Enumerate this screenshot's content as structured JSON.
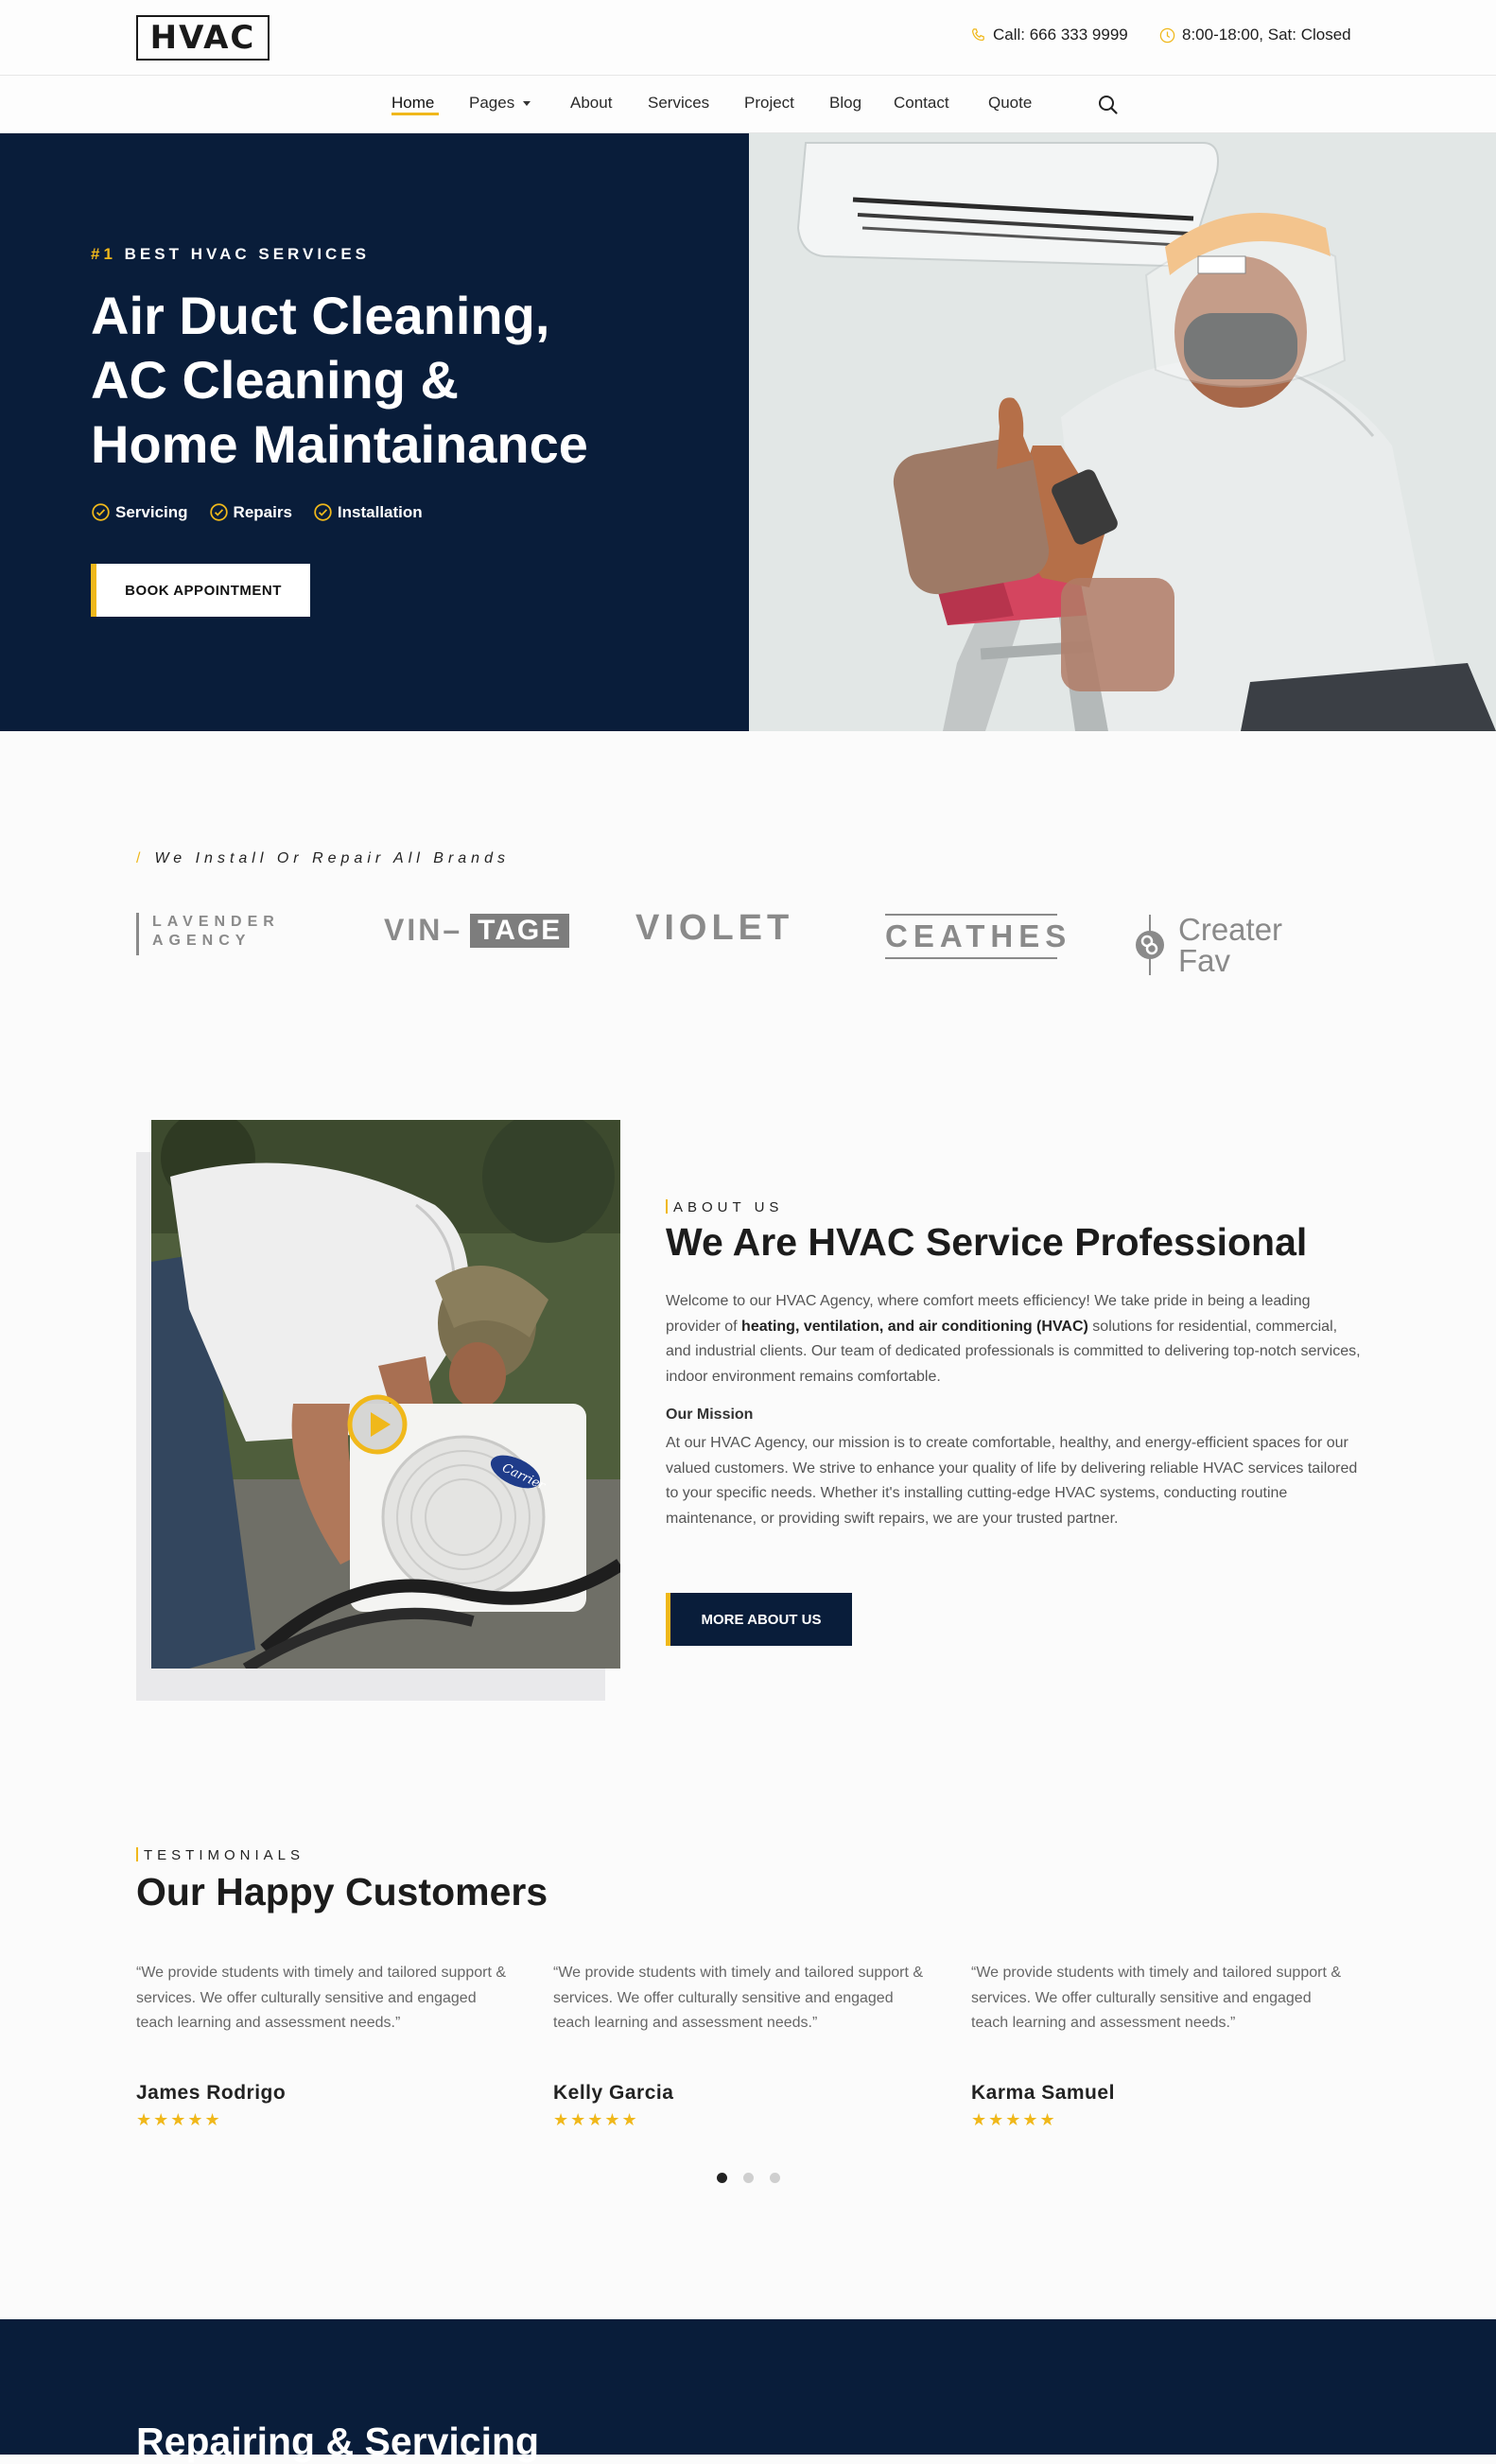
{
  "header": {
    "logo": "HVAC",
    "phone": "Call: 666 333 9999",
    "hours": "8:00-18:00, Sat: Closed"
  },
  "nav": {
    "items": [
      "Home",
      "Pages",
      "About",
      "Services",
      "Project",
      "Blog",
      "Contact",
      "Quote"
    ],
    "active": "Home"
  },
  "hero": {
    "kicker_hash": "#1",
    "kicker": "BEST HVAC SERVICES",
    "title_line1": "Air Duct Cleaning,",
    "title_line2": "AC Cleaning &",
    "title_line3": "Home Maintainance",
    "tags": [
      "Servicing",
      "Repairs",
      "Installation"
    ],
    "cta": "BOOK APPOINTMENT"
  },
  "brands": {
    "kicker": "We Install Or Repair All Brands",
    "logos": {
      "lavender_1": "LAVENDER",
      "lavender_2": "AGENCY",
      "vintage_1": "VIN–",
      "vintage_2": "TAGE",
      "violet": "VIOLET",
      "ceathes": "CEATHES",
      "creater_1": "Creater",
      "creater_2": "Fav"
    }
  },
  "about": {
    "kicker": "ABOUT US",
    "title": "We Are HVAC Service Professional",
    "p1_a": "Welcome to our HVAC Agency, where comfort meets efficiency! We take pride in being a leading provider of ",
    "p1_bold": "heating, ventilation, and air conditioning (HVAC)",
    "p1_b": " solutions for residential, commercial, and industrial clients. Our team of dedicated professionals is committed to delivering top-notch services, indoor environment remains comfortable.",
    "mission_heading": "Our Mission",
    "mission_text": "At our HVAC Agency, our mission is to create comfortable, healthy, and energy-efficient spaces for our valued customers. We strive to enhance your quality of life by delivering reliable HVAC services tailored to your specific needs. Whether it's installing cutting-edge HVAC systems, conducting routine maintenance, or providing swift repairs, we are your trusted partner.",
    "cta": "MORE ABOUT US",
    "unit_brand": "Carrier"
  },
  "testimonials": {
    "kicker": "TESTIMONIALS",
    "title": "Our Happy Customers",
    "items": [
      {
        "quote": "“We provide students with timely and tailored support & services. We offer culturally sensitive and engaged teach learning and assessment needs.”",
        "name": "James Rodrigo",
        "rating": 5
      },
      {
        "quote": "“We provide students with timely and tailored support & services. We offer culturally sensitive and engaged teach learning and assessment needs.”",
        "name": "Kelly Garcia",
        "rating": 5
      },
      {
        "quote": "“We provide students with timely and tailored support & services. We offer culturally sensitive and engaged teach learning and assessment needs.”",
        "name": "Karma Samuel",
        "rating": 5
      }
    ],
    "stars": "★★★★★",
    "carousel_pages": 3,
    "carousel_active": 1
  },
  "bottom": {
    "title": "Repairing & Servicing"
  },
  "colors": {
    "navy": "#091d3a",
    "accent": "#f0b81b",
    "text": "#222222",
    "muted": "#666666"
  },
  "icons": [
    "phone-icon",
    "clock-icon",
    "search-icon",
    "check-circle-icon",
    "play-icon",
    "caret-down-icon"
  ]
}
